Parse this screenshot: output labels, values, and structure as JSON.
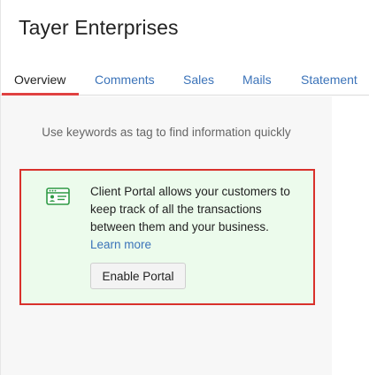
{
  "header": {
    "title": "Tayer Enterprises"
  },
  "tabs": [
    {
      "label": "Overview",
      "active": true
    },
    {
      "label": "Comments",
      "active": false
    },
    {
      "label": "Sales",
      "active": false
    },
    {
      "label": "Mails",
      "active": false
    },
    {
      "label": "Statement",
      "active": false
    }
  ],
  "overview": {
    "keywords_hint": "Use keywords as tag to find information quickly",
    "portal_card": {
      "icon": "portal-icon",
      "description": "Client Portal allows your customers to keep track of all the transactions between them and your business.",
      "learn_more": "Learn more",
      "enable_button": "Enable Portal"
    }
  },
  "colors": {
    "accent_blue": "#3b73b9",
    "active_tab_underline": "#e04141",
    "highlight_border": "#d9312b",
    "card_background": "#ecfbec",
    "icon_green": "#2e9a45"
  }
}
